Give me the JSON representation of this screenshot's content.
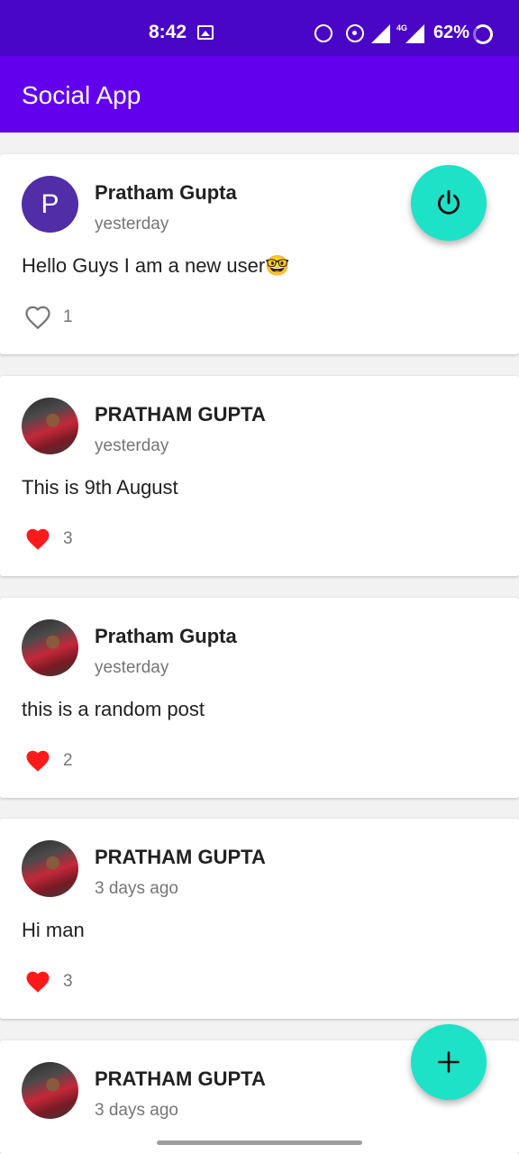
{
  "status_bar": {
    "time": "8:42",
    "network": "4G",
    "battery": "62%"
  },
  "app_bar": {
    "title": "Social App"
  },
  "posts": [
    {
      "author": "Pratham Gupta",
      "avatar_letter": "P",
      "time": "yesterday",
      "text": "Hello Guys I am a new user🤓",
      "likes": "1",
      "liked": false
    },
    {
      "author": "PRATHAM GUPTA",
      "time": "yesterday",
      "text": "This is 9th August",
      "likes": "3",
      "liked": true
    },
    {
      "author": "Pratham Gupta",
      "time": "yesterday",
      "text": "this is a random post",
      "likes": "2",
      "liked": true
    },
    {
      "author": "PRATHAM GUPTA",
      "time": "3 days ago",
      "text": "Hi man",
      "likes": "3",
      "liked": true
    },
    {
      "author": "PRATHAM GUPTA",
      "time": "3 days ago",
      "text": "",
      "likes": "",
      "liked": false
    }
  ],
  "colors": {
    "status_bar": "#4a06c6",
    "app_bar": "#6200ee",
    "fab": "#1de2c8",
    "like_active": "#ff1a1a",
    "like_inactive": "#757575",
    "avatar_letter_bg": "#512da8"
  },
  "icons": {
    "logout_fab": "power-icon",
    "add_fab": "plus-icon",
    "like": "heart-icon"
  }
}
